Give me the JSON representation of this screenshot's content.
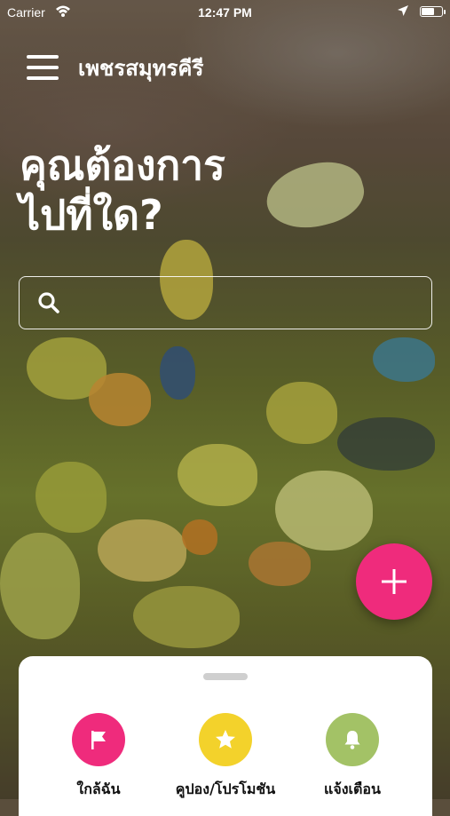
{
  "status_bar": {
    "carrier": "Carrier",
    "time": "12:47 PM",
    "battery_level": 0.6
  },
  "header": {
    "title": "เพชรสมุทรคีรี",
    "menu_icon": "hamburger-menu-icon"
  },
  "hero": {
    "line1": "คุณต้องการ",
    "line2": "ไปที่ใด?"
  },
  "search": {
    "placeholder": "",
    "value": "",
    "icon": "search-icon"
  },
  "fab": {
    "icon": "plus-icon",
    "color": "#ef2b7c"
  },
  "bottom_sheet": {
    "items": [
      {
        "label": "ใกล้ฉัน",
        "icon": "flag-icon",
        "color": "#ef2b7c"
      },
      {
        "label": "คูปอง/โปรโมชัน",
        "icon": "star-icon",
        "color": "#f3d22b"
      },
      {
        "label": "แจ้งเตือน",
        "icon": "bell-icon",
        "color": "#a3c266"
      }
    ]
  }
}
